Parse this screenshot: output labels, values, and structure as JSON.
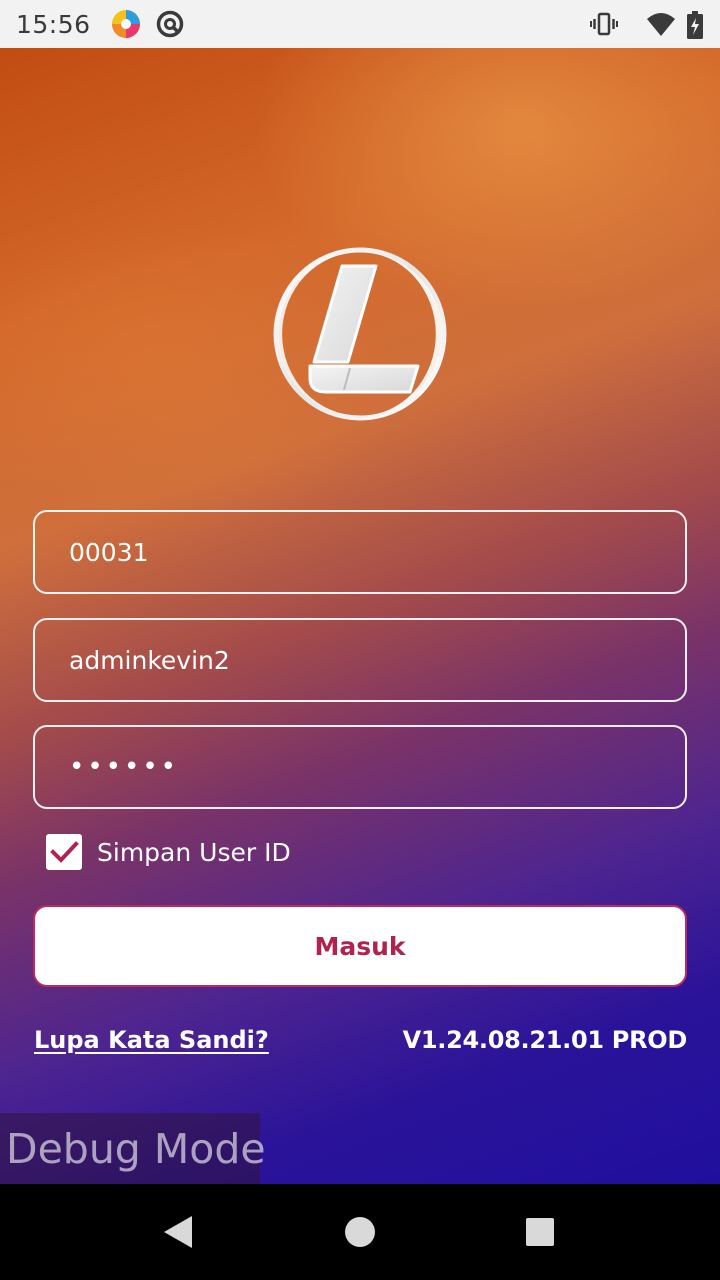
{
  "status_bar": {
    "time": "15:56",
    "icons": [
      "app-notification-icon",
      "sync-icon",
      "vibrate-icon",
      "wifi-icon",
      "battery-charging-icon"
    ]
  },
  "login_form": {
    "company_code_value": "00031",
    "user_id_value": "adminkevin2",
    "password_value": "••••••",
    "remember_label": "Simpan User ID",
    "remember_checked": true,
    "submit_label": "Masuk",
    "forgot_password_label": "Lupa Kata Sandi?",
    "version_label": "V1.24.08.21.01 PROD"
  },
  "debug_label": "Debug Mode",
  "colors": {
    "accent": "#b0234f",
    "gradient_top": "#c24c12",
    "gradient_bottom": "#200f9e"
  },
  "nav_bar": {
    "icons": [
      "back-icon",
      "home-icon",
      "recents-icon"
    ]
  }
}
